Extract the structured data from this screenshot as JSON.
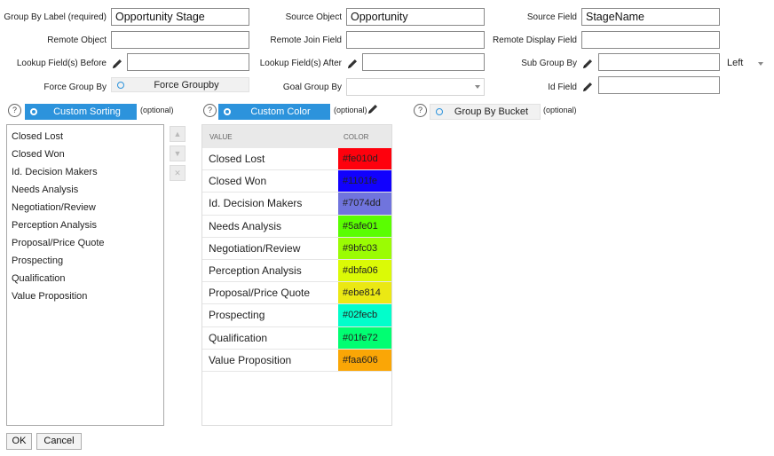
{
  "form": {
    "row1": {
      "group_by_label": {
        "label": "Group By Label (required)",
        "value": "Opportunity Stage"
      },
      "source_object": {
        "label": "Source Object",
        "value": "Opportunity"
      },
      "source_field": {
        "label": "Source Field",
        "value": "StageName"
      }
    },
    "row2": {
      "remote_object": {
        "label": "Remote Object",
        "value": ""
      },
      "remote_join_field": {
        "label": "Remote Join Field",
        "value": ""
      },
      "remote_display_field": {
        "label": "Remote Display Field",
        "value": ""
      }
    },
    "row3": {
      "lookup_before": {
        "label": "Lookup Field(s) Before",
        "value": ""
      },
      "lookup_after": {
        "label": "Lookup Field(s) After",
        "value": ""
      },
      "sub_group_by": {
        "label": "Sub Group By",
        "value": "",
        "align_value": "Left"
      }
    },
    "row4": {
      "force_group_by": {
        "label": "Force Group By",
        "toggle_label": "Force Groupby"
      },
      "goal_group_by": {
        "label": "Goal Group By",
        "value": ""
      },
      "id_field": {
        "label": "Id Field",
        "value": ""
      }
    }
  },
  "toggles": {
    "custom_sorting": {
      "label": "Custom Sorting",
      "optional": "(optional)",
      "help": "?"
    },
    "custom_color": {
      "label": "Custom Color",
      "optional": "(optional)",
      "help": "?"
    },
    "group_by_bucket": {
      "label": "Group By Bucket",
      "optional": "(optional)",
      "help": "?"
    }
  },
  "sort_list": {
    "items": [
      "Closed Lost",
      "Closed Won",
      "Id. Decision Makers",
      "Needs Analysis",
      "Negotiation/Review",
      "Perception Analysis",
      "Proposal/Price Quote",
      "Prospecting",
      "Qualification",
      "Value Proposition"
    ],
    "up_glyph": "▲",
    "down_glyph": "▼",
    "remove_glyph": "✕"
  },
  "color_table": {
    "headers": {
      "value": "VALUE",
      "color": "COLOR"
    },
    "rows": [
      {
        "value": "Closed Lost",
        "color": "#fe010d"
      },
      {
        "value": "Closed Won",
        "color": "#1101fe"
      },
      {
        "value": "Id. Decision Makers",
        "color": "#7074dd"
      },
      {
        "value": "Needs Analysis",
        "color": "#5afe01"
      },
      {
        "value": "Negotiation/Review",
        "color": "#9bfc03"
      },
      {
        "value": "Perception Analysis",
        "color": "#dbfa06"
      },
      {
        "value": "Proposal/Price Quote",
        "color": "#ebe814"
      },
      {
        "value": "Prospecting",
        "color": "#02fecb"
      },
      {
        "value": "Qualification",
        "color": "#01fe72"
      },
      {
        "value": "Value Proposition",
        "color": "#faa606"
      }
    ]
  },
  "buttons": {
    "ok": "OK",
    "cancel": "Cancel"
  },
  "colors": {
    "accent": "#2c93dc",
    "border": "#8a8a8a"
  },
  "icons": {
    "pencil": "pencil-icon",
    "help": "help-circle-icon",
    "dropdown": "chevron-down-icon"
  }
}
